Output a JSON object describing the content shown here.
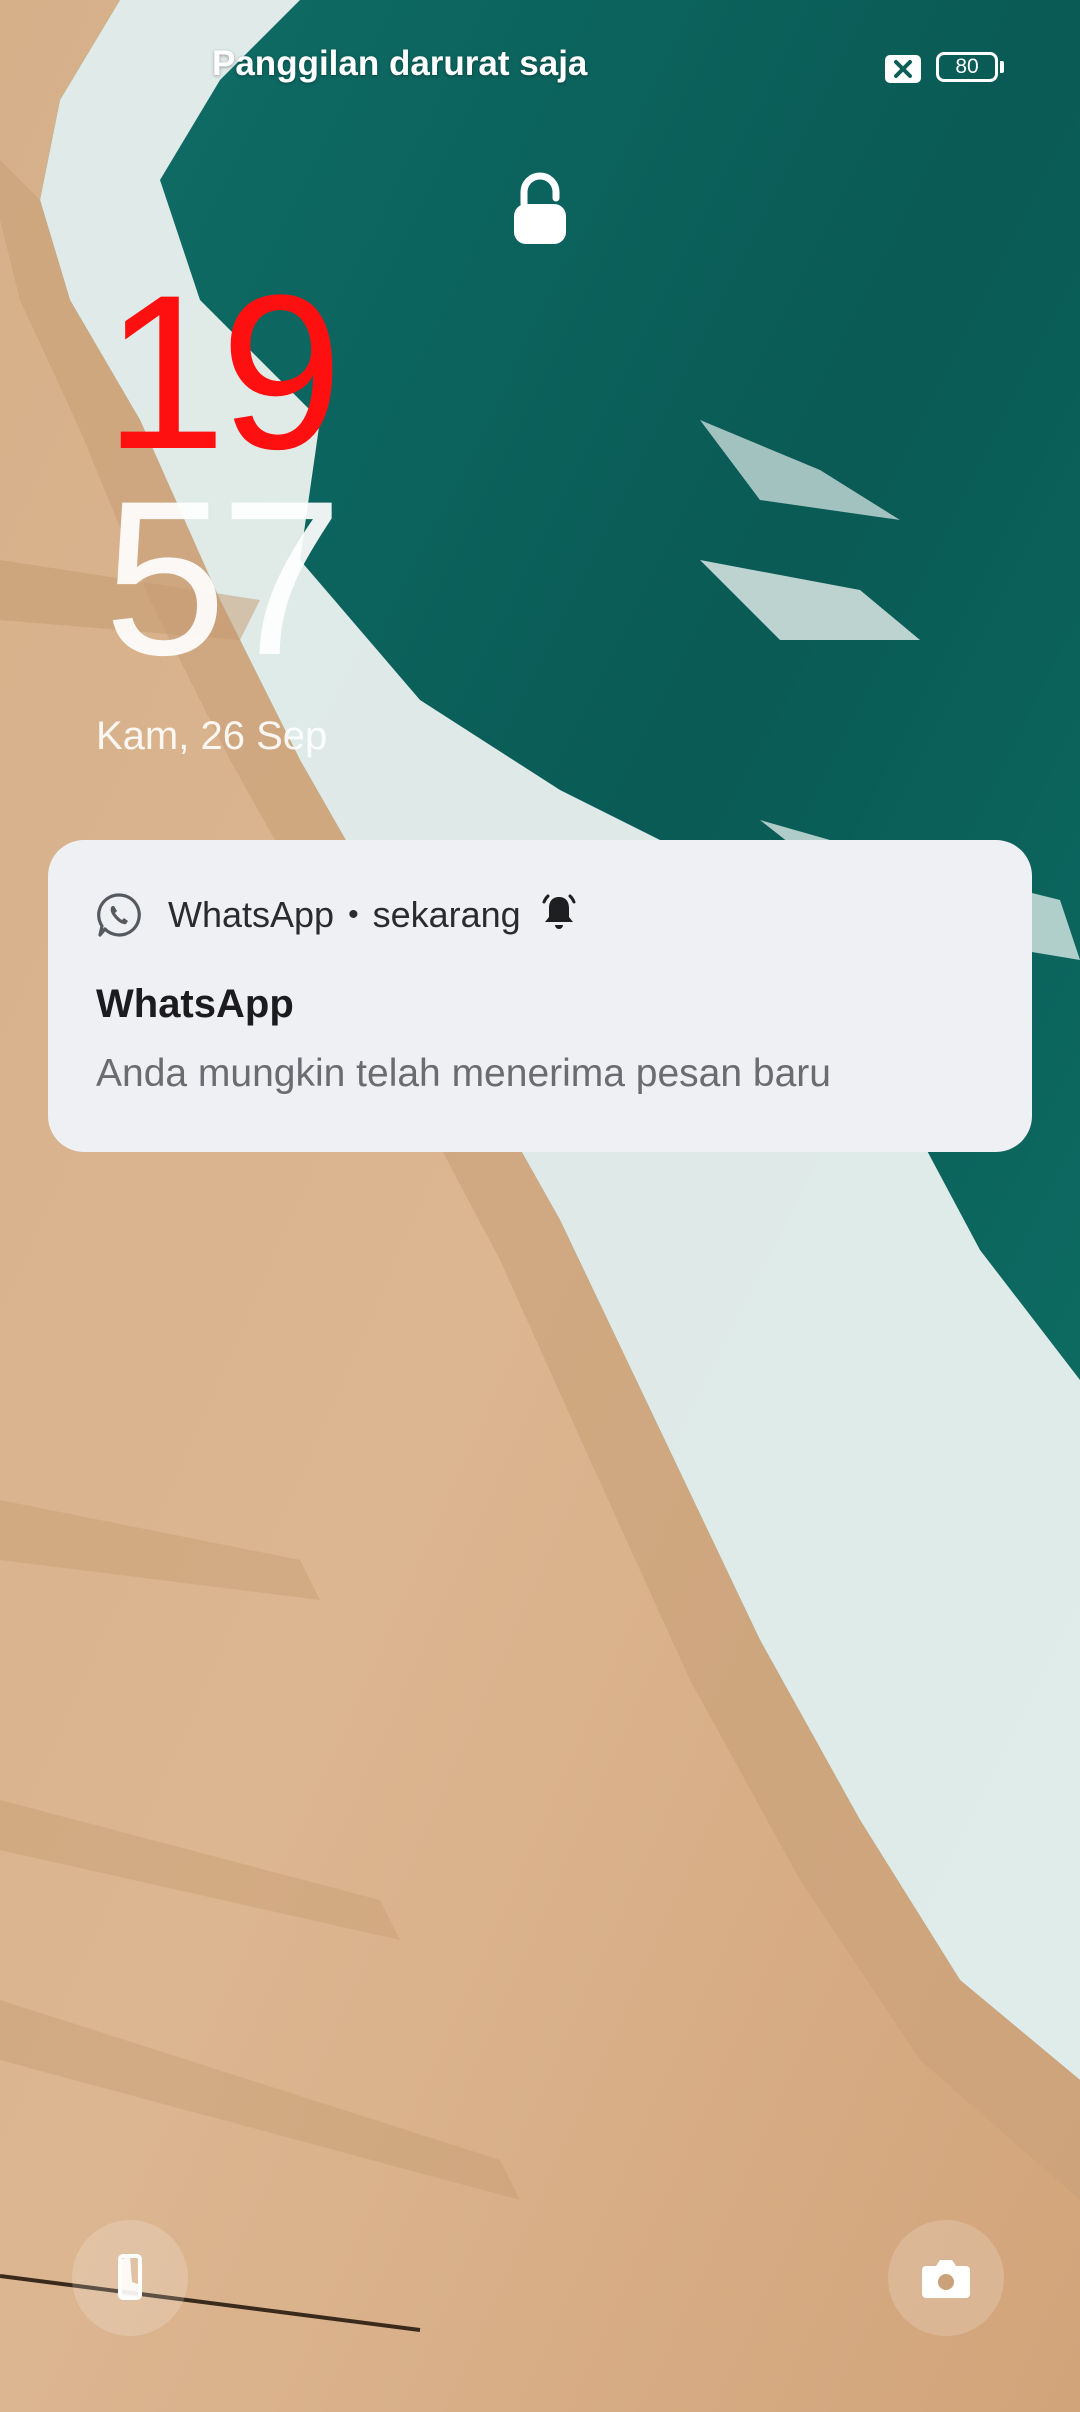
{
  "status_bar": {
    "carrier_text": "Panggilan darurat saja",
    "nosim_icon": "no-sim-icon",
    "battery_level": "80"
  },
  "lockscreen": {
    "lock_icon": "lock-open-icon",
    "clock_hours": "19",
    "clock_minutes": "57",
    "date": "Kam, 26 Sep",
    "colors": {
      "hours": "#ff1010",
      "minutes": "#ffffff"
    }
  },
  "notification": {
    "app_icon": "whatsapp-icon",
    "app_name": "WhatsApp",
    "separator": "•",
    "time": "sekarang",
    "alert_icon": "bell-alert-icon",
    "title": "WhatsApp",
    "body": "Anda mungkin telah menerima pesan baru"
  },
  "shortcuts": {
    "left_icon": "phone-icon",
    "right_icon": "camera-icon"
  }
}
